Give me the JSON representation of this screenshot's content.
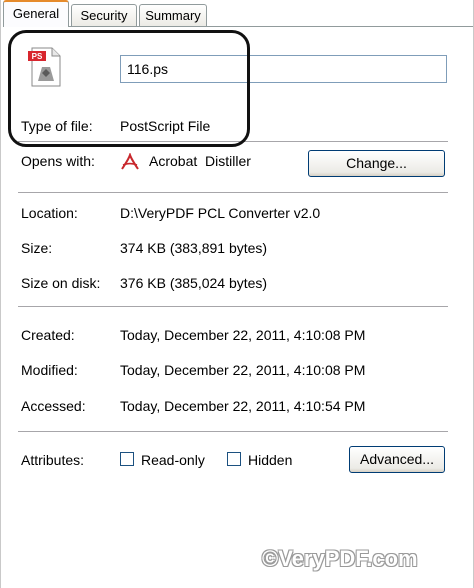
{
  "tabs": [
    {
      "label": "General",
      "active": true
    },
    {
      "label": "Security",
      "active": false
    },
    {
      "label": "Summary",
      "active": false
    }
  ],
  "file": {
    "icon": "postscript-file-icon",
    "icon_badge": "PS",
    "name": "116.ps"
  },
  "type_of_file": {
    "label": "Type of file:",
    "value": "PostScript File"
  },
  "opens_with": {
    "label": "Opens with:",
    "app_icon": "acrobat-distiller-icon",
    "app": "Acrobat  Distiller",
    "change_button": "Change..."
  },
  "location": {
    "label": "Location:",
    "value": "D:\\VeryPDF PCL Converter v2.0"
  },
  "size": {
    "label": "Size:",
    "value": "374 KB (383,891 bytes)"
  },
  "size_on_disk": {
    "label": "Size on disk:",
    "value": "376 KB (385,024 bytes)"
  },
  "created": {
    "label": "Created:",
    "value": "Today, December 22, 2011, 4:10:08 PM"
  },
  "modified": {
    "label": "Modified:",
    "value": "Today, December 22, 2011, 4:10:08 PM"
  },
  "accessed": {
    "label": "Accessed:",
    "value": "Today, December 22, 2011, 4:10:54 PM"
  },
  "attributes": {
    "label": "Attributes:",
    "read_only": {
      "label": "Read-only",
      "checked": false
    },
    "hidden": {
      "label": "Hidden",
      "checked": false
    },
    "advanced_button": "Advanced..."
  },
  "watermark": "©VeryPDF.com",
  "colors": {
    "tab_highlight": "#e68b2c",
    "button_border": "#003c74",
    "input_border": "#7f9db9"
  }
}
